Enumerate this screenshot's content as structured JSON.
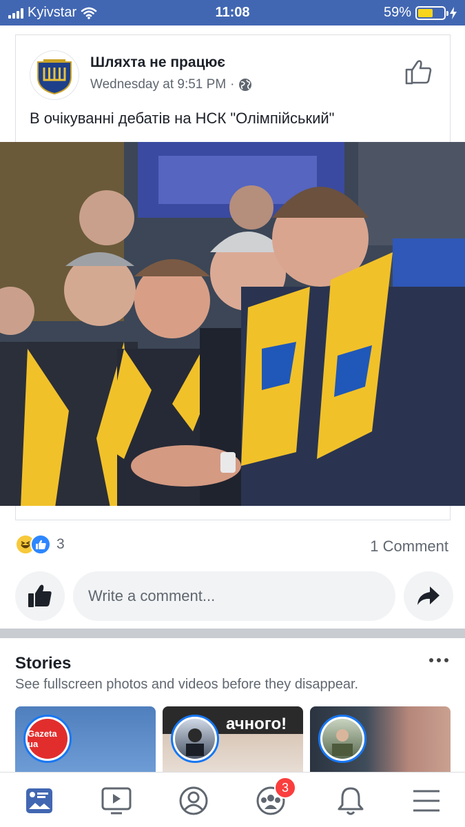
{
  "status_bar": {
    "carrier": "Kyivstar",
    "time": "11:08",
    "battery": "59%",
    "battery_level": 0.59
  },
  "post": {
    "page_name": "Шляхта не працює",
    "timestamp": "Wednesday at 9:51 PM",
    "separator": "·",
    "privacy_icon": "globe-icon",
    "text": "В очікуванні дебатів на НСК \"Олімпійський\"",
    "reaction_count": "3",
    "comments": "1 Comment",
    "comment_placeholder": "Write a comment...",
    "reactions": [
      "haha-icon",
      "like-icon"
    ]
  },
  "stories": {
    "title": "Stories",
    "subtitle": "See fullscreen photos and videos before they disappear.",
    "items": [
      {
        "avatar_text": "Gazeta ua"
      },
      {
        "headline": "ачного!"
      },
      {
        "avatar_text": ""
      }
    ]
  },
  "tabbar": {
    "groups_badge": "3"
  },
  "colors": {
    "brand": "#4267b2",
    "badge": "#fa3e3e",
    "like_blue": "#2d86ff"
  }
}
